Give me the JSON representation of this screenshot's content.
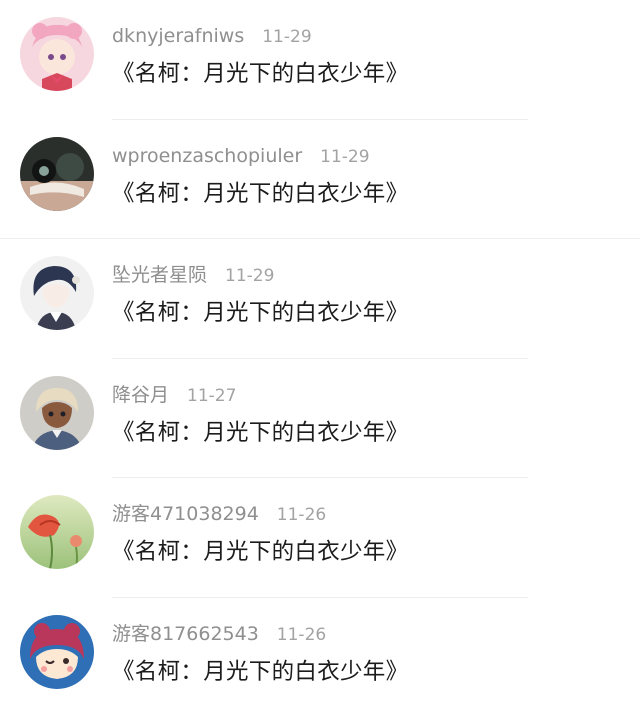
{
  "comments": [
    {
      "user": "dknyjerafniws",
      "date": "11-29",
      "text": "《名柯：月光下的白衣少年》",
      "avatar": "pink-anime-girl-avatar-icon"
    },
    {
      "user": "wproenzaschopiuler",
      "date": "11-29",
      "text": "《名柯：月光下的白衣少年》",
      "avatar": "dark-photo-avatar-icon"
    },
    {
      "user": "坠光者星陨",
      "date": "11-29",
      "text": "《名柯：月光下的白衣少年》",
      "avatar": "blue-hair-anime-boy-avatar-icon"
    },
    {
      "user": "降谷月",
      "date": "11-27",
      "text": "《名柯：月光下的白衣少年》",
      "avatar": "blonde-anime-man-avatar-icon"
    },
    {
      "user": "游客471038294",
      "date": "11-26",
      "text": "《名柯：月光下的白衣少年》",
      "avatar": "red-flower-avatar-icon"
    },
    {
      "user": "游客817662543",
      "date": "11-26",
      "text": "《名柯：月光下的白衣少年》",
      "avatar": "cartoon-girl-avatar-icon"
    }
  ]
}
